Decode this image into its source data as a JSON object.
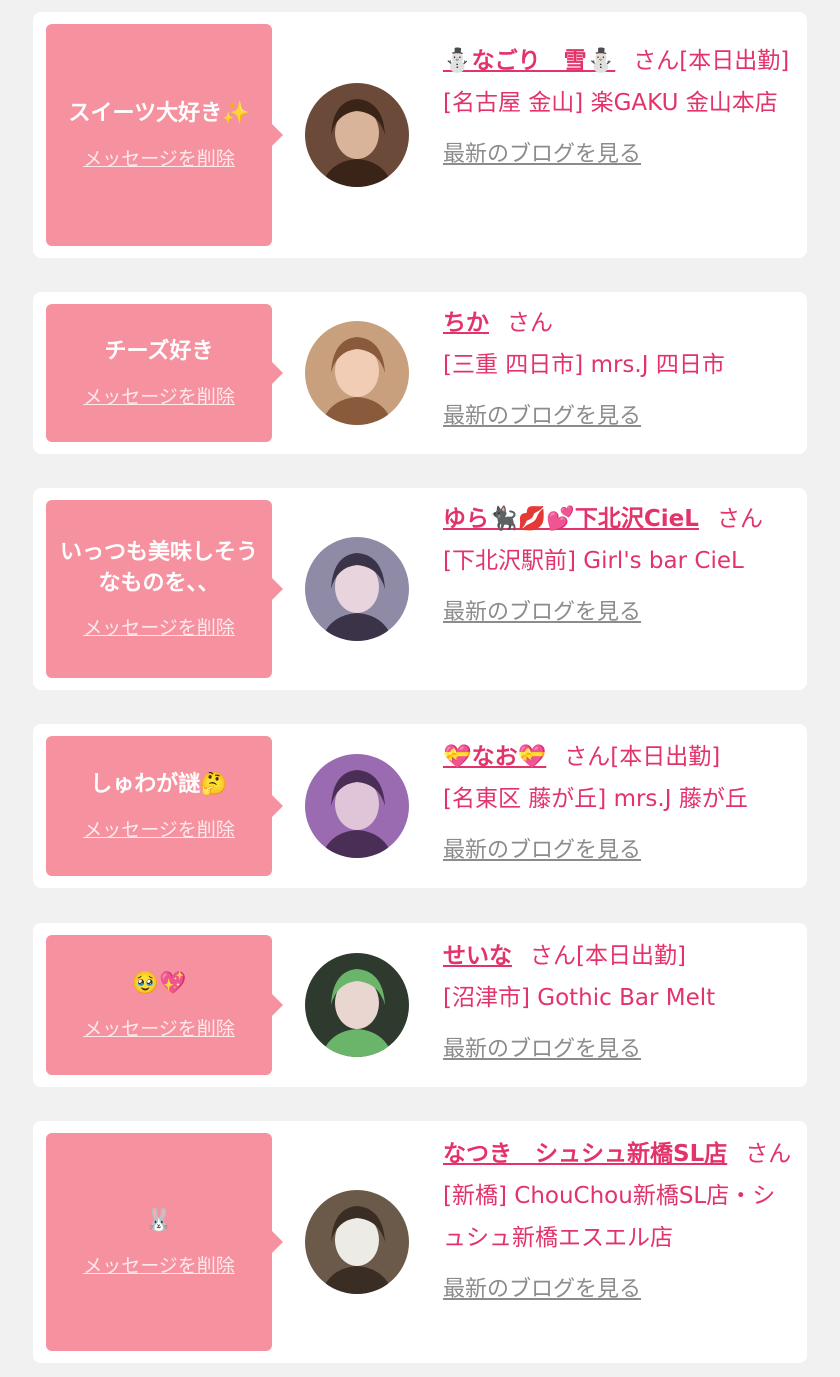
{
  "accent_color": "#e2336b",
  "bubble_color": "#f6929f",
  "delete_label": "メッセージを削除",
  "blog_label": "最新のブログを見る",
  "san_label": "さん",
  "items": [
    {
      "message": "スイーツ大好き✨",
      "name": "⛄なごり　雪⛄",
      "status": "[本日出勤]",
      "shop": "[名古屋 金山] 楽GAKU 金山本店",
      "avatar_icon": "profile-photo"
    },
    {
      "message": "チーズ好き",
      "name": "ちか",
      "status": "",
      "shop": "[三重 四日市] mrs.J 四日市",
      "avatar_icon": "profile-photo"
    },
    {
      "message": "いっつも美味しそうなものを、、",
      "name": "ゆら🐈‍⬛💋💕下北沢CieL",
      "status": "",
      "shop": "[下北沢駅前] Girl's bar CieL",
      "avatar_icon": "profile-photo"
    },
    {
      "message": "しゅわが謎🤔",
      "name": "💝なお💝",
      "status": "[本日出勤]",
      "shop": "[名東区 藤が丘] mrs.J 藤が丘",
      "avatar_icon": "profile-photo"
    },
    {
      "message": "🥹💖",
      "name": "せいな",
      "status": "[本日出勤]",
      "shop": "[沼津市] Gothic Bar Melt",
      "avatar_icon": "profile-photo"
    },
    {
      "message": "🐰",
      "name": "なつき　シュシュ新橋SL店",
      "status": "",
      "shop": "[新橋] ChouChou新橋SL店・シュシュ新橋エスエル店",
      "avatar_icon": "profile-photo"
    }
  ]
}
